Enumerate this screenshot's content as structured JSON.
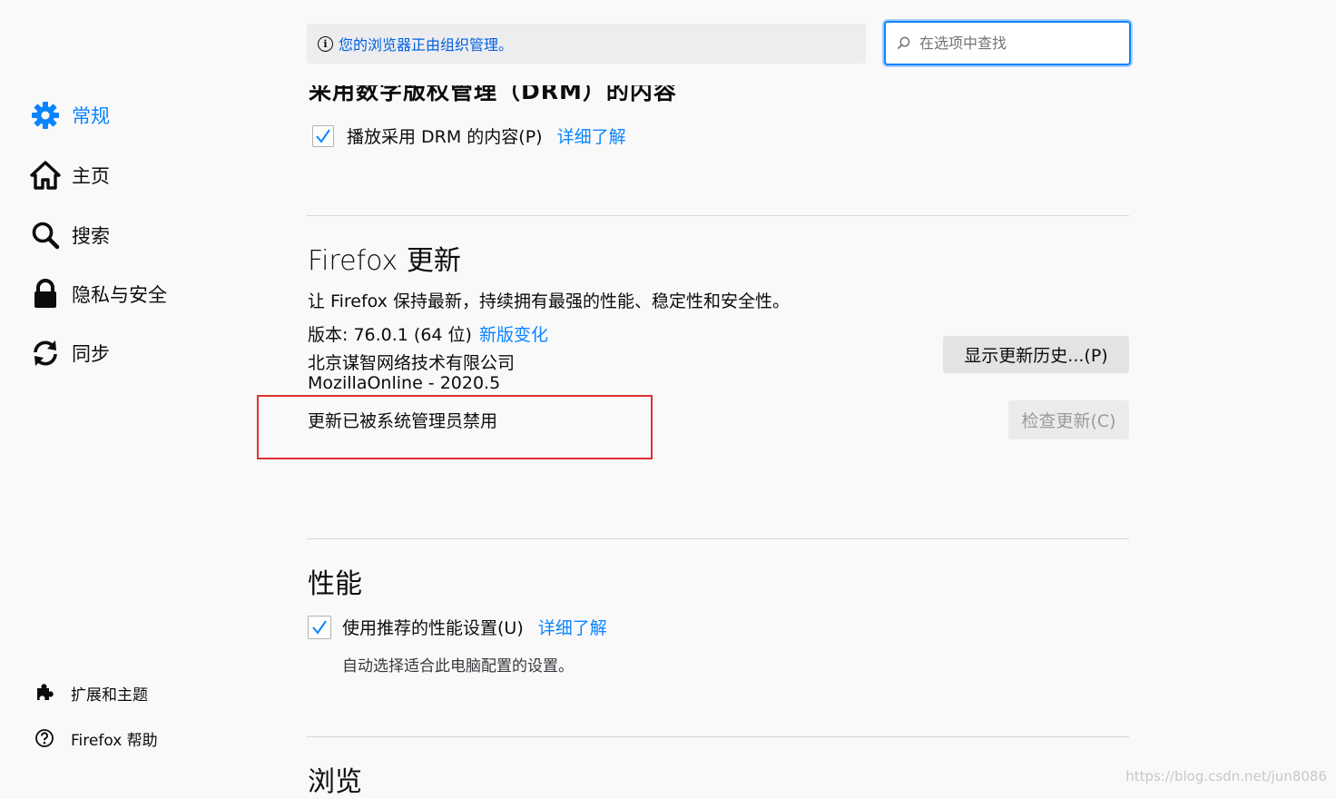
{
  "banner": {
    "text": "您的浏览器正由组织管理。"
  },
  "search": {
    "placeholder": "在选项中查找"
  },
  "sidebar": {
    "items": [
      {
        "label": "常规",
        "icon": "gear-icon",
        "active": true
      },
      {
        "label": "主页",
        "icon": "home-icon"
      },
      {
        "label": "搜索",
        "icon": "search-icon"
      },
      {
        "label": "隐私与安全",
        "icon": "lock-icon"
      },
      {
        "label": "同步",
        "icon": "sync-icon"
      }
    ],
    "footer": [
      {
        "label": "扩展和主题",
        "icon": "puzzle-icon"
      },
      {
        "label": "Firefox 帮助",
        "icon": "help-icon"
      }
    ]
  },
  "drm": {
    "heading_partial": "采用数字版权管理（DRM）的内容",
    "checkbox_label": "播放采用 DRM 的内容(P)",
    "checked": true,
    "learn_more": "详细了解"
  },
  "update": {
    "title": "Firefox 更新",
    "description": "让 Firefox 保持最新，持续拥有最强的性能、稳定性和安全性。",
    "version_label": "版本: 76.0.1 (64 位)",
    "whats_new": "新版变化",
    "company": "北京谋智网络技术有限公司",
    "build": "MozillaOnline - 2020.5",
    "disabled_notice": "更新已被系统管理员禁用",
    "history_button": "显示更新历史...(P)",
    "check_button": "检查更新(C)"
  },
  "performance": {
    "title": "性能",
    "checkbox_label": "使用推荐的性能设置(U)",
    "checked": true,
    "learn_more": "详细了解",
    "hint": "自动选择适合此电脑配置的设置。"
  },
  "browsing": {
    "title": "浏览"
  },
  "watermark": "https://blog.csdn.net/jun8086",
  "colors": {
    "accent": "#0a84ff",
    "highlight_box": "#e0312e",
    "banner_text": "#0060df"
  }
}
